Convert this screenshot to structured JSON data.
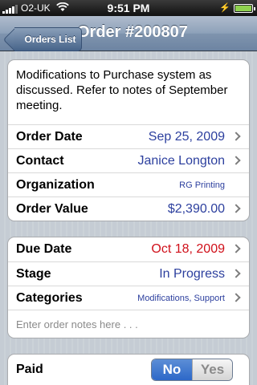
{
  "status_bar": {
    "carrier": "O2-UK",
    "time": "9:51 PM"
  },
  "nav": {
    "back_label": "Orders List",
    "title": "Order #200807"
  },
  "details": {
    "description": "Modifications to Purchase system as discussed.  Refer to notes of September meeting.",
    "rows": [
      {
        "label": "Order Date",
        "value": "Sep 25, 2009"
      },
      {
        "label": "Contact",
        "value": "Janice Longton"
      },
      {
        "label": "Organization",
        "value": "RG Printing"
      },
      {
        "label": "Order Value",
        "value": "$2,390.00"
      }
    ]
  },
  "schedule": {
    "rows": [
      {
        "label": "Due Date",
        "value": "Oct 18, 2009"
      },
      {
        "label": "Stage",
        "value": "In Progress"
      },
      {
        "label": "Categories",
        "value": "Modifications, Support"
      }
    ],
    "notes_placeholder": "Enter order notes here . . ."
  },
  "payment": {
    "label": "Paid",
    "options": [
      "No",
      "Yes"
    ],
    "selected": "No"
  },
  "colors": {
    "value_blue": "#2c3f9e",
    "due_red": "#d0101a",
    "segment_selected": "#2d68c8"
  }
}
